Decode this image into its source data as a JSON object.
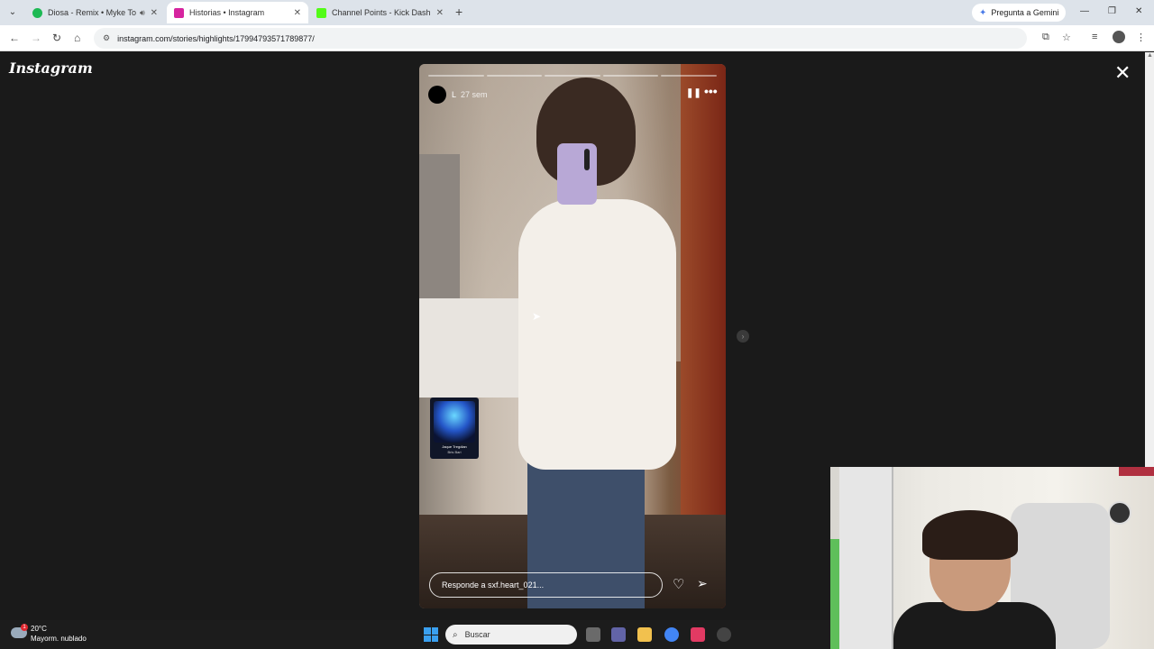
{
  "browser": {
    "tabs": [
      {
        "title": "Diosa - Remix • Myke Towe",
        "favicon_color": "#1db954",
        "active": false,
        "audio": true
      },
      {
        "title": "Historias • Instagram",
        "favicon_color": "#d6249f",
        "active": true,
        "audio": false
      },
      {
        "title": "Channel Points - Kick Dashboa",
        "favicon_color": "#53fc18",
        "active": false,
        "audio": false
      }
    ],
    "new_tab": "+",
    "gemini_label": "Pregunta a Gemini",
    "url": "instagram.com/stories/highlights/17994793571789877/"
  },
  "page": {
    "logo": "Instagram",
    "close": "✕",
    "story": {
      "username": "L",
      "time_ago": "27 sem",
      "segments": 5,
      "reply_placeholder": "Responde a sxf.heart_021...",
      "music_title": "Jaque Tregdian",
      "music_artist": "Bris Bari"
    },
    "next_arrow": "›"
  },
  "taskbar": {
    "temperature": "20°C",
    "condition": "Mayorm. nublado",
    "alert_count": "1",
    "search_placeholder": "Buscar"
  }
}
